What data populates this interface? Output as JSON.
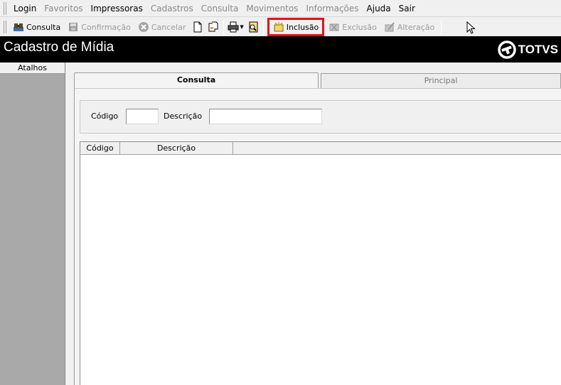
{
  "menu": {
    "items": [
      {
        "label": "Login",
        "enabled": true
      },
      {
        "label": "Favoritos",
        "enabled": false
      },
      {
        "label": "Impressoras",
        "enabled": true
      },
      {
        "label": "Cadastros",
        "enabled": false
      },
      {
        "label": "Consulta",
        "enabled": false
      },
      {
        "label": "Movimentos",
        "enabled": false
      },
      {
        "label": "Informações",
        "enabled": false
      },
      {
        "label": "Ajuda",
        "enabled": true
      },
      {
        "label": "Sair",
        "enabled": true
      }
    ]
  },
  "toolbar": {
    "consulta_label": "Consulta",
    "confirmacao_label": "Confirmação",
    "cancelar_label": "Cancelar",
    "inclusao_label": "Inclusão",
    "exclusao_label": "Exclusão",
    "alteracao_label": "Alteração",
    "highlight_color": "#e0121b"
  },
  "window": {
    "title": "Cadastro de Mídia",
    "logo_text": "TOTVS"
  },
  "sidebar": {
    "header": "Atalhos"
  },
  "tabs": [
    {
      "label": "Consulta",
      "active": true
    },
    {
      "label": "Principal",
      "active": false
    }
  ],
  "filters": {
    "codigo_label": "Código",
    "codigo_value": "",
    "descricao_label": "Descrição",
    "descricao_value": ""
  },
  "grid": {
    "columns": [
      "Código",
      "Descrição"
    ],
    "rows": []
  }
}
